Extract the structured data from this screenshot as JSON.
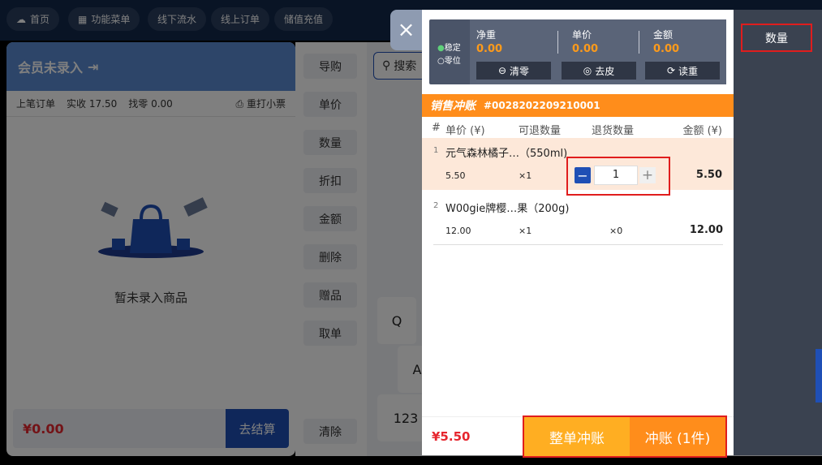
{
  "topnav": [
    "首页",
    "功能菜单",
    "线下流水",
    "线上订单",
    "储值充值"
  ],
  "left": {
    "member_title": "会员未录入",
    "last_order_label": "上笔订单",
    "paid_label": "实收",
    "paid_value": "17.50",
    "change_label": "找零",
    "change_value": "0.00",
    "reprint": "重打小票",
    "empty_text": "暂未录入商品",
    "total": "¥0.00",
    "checkout": "去结算"
  },
  "mid_buttons": [
    "导购",
    "单价",
    "数量",
    "折扣",
    "金额",
    "删除",
    "赠品",
    "取单",
    "清除"
  ],
  "search": {
    "placeholder": "搜索"
  },
  "keyboard": [
    "Q",
    "A",
    "123"
  ],
  "qty_label": "数量",
  "close": "×",
  "scale": {
    "stable": "稳定",
    "zero": "零位",
    "net_weight_label": "净重",
    "net_weight": "0.00",
    "unit_price_label": "单价",
    "unit_price": "0.00",
    "amount_label": "金额",
    "amount": "0.00",
    "btn_clear": "清零",
    "btn_tare": "去皮",
    "btn_read": "读重"
  },
  "banner": {
    "title": "销售冲账",
    "order_no": "#0028202209210001"
  },
  "table_header": {
    "idx": "#",
    "price": "单价 (¥)",
    "refundable": "可退数量",
    "refund": "退货数量",
    "amount": "金额 (¥)"
  },
  "rows": [
    {
      "idx": "1",
      "name": "元气森林橘子…（550ml)",
      "price": "5.50",
      "refundable": "×1",
      "refund_qty": "1",
      "amount": "5.50"
    },
    {
      "idx": "2",
      "name": "W00gie牌樱…果（200g)",
      "price": "12.00",
      "refundable": "×1",
      "refund": "×0",
      "amount": "12.00"
    }
  ],
  "footer": {
    "total": "¥5.50",
    "whole": "整单冲账",
    "partial": "冲账 (1件)"
  },
  "colors": {
    "accent": "#1f4fb5",
    "orange": "#ff8d1b",
    "highlight": "#e01d1d"
  }
}
